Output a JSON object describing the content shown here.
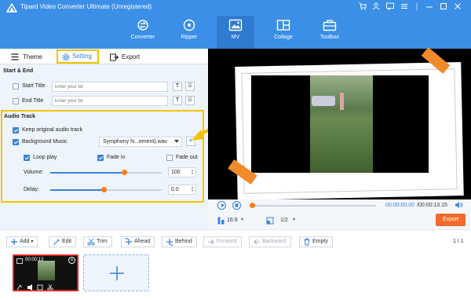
{
  "window": {
    "title": "Tipard Video Converter Ultimate (Unregistered)"
  },
  "nav": {
    "tabs": [
      {
        "label": "Converter",
        "icon": "converter-icon"
      },
      {
        "label": "Ripper",
        "icon": "ripper-icon"
      },
      {
        "label": "MV",
        "icon": "mv-icon",
        "active": true
      },
      {
        "label": "Collage",
        "icon": "collage-icon"
      },
      {
        "label": "Toolbox",
        "icon": "toolbox-icon"
      }
    ]
  },
  "subtabs": {
    "theme": "Theme",
    "setting": "Setting",
    "export": "Export"
  },
  "start_end": {
    "title": "Start & End",
    "start_title": {
      "label": "Start Title",
      "placeholder": "Enter your txt",
      "checked": false
    },
    "end_title": {
      "label": "End Title",
      "placeholder": "Enter your txt",
      "checked": false
    }
  },
  "audio": {
    "title": "Audio Track",
    "keep_original": {
      "label": "Keep original audio track",
      "checked": true
    },
    "background_music": {
      "label": "Background Music",
      "checked": true,
      "selected": "Symphony N...ement).wav"
    },
    "loop_play": {
      "label": "Loop play",
      "checked": true
    },
    "fade_in": {
      "label": "Fade in",
      "checked": true
    },
    "fade_out": {
      "label": "Fade out",
      "checked": false
    },
    "volume": {
      "label": "Volume:",
      "value": "100",
      "level": 0.66
    },
    "delay": {
      "label": "Delay:",
      "value": "0.0",
      "level": 0.48
    }
  },
  "player": {
    "time_current": "00:00:00.00",
    "time_total": "/00:00:13.15",
    "aspect": "16:9",
    "scale": "1/2",
    "export_label": "Export",
    "progress": 0.0
  },
  "toolbar": {
    "add": "Add",
    "edit": "Edit",
    "trim": "Trim",
    "ahead": "Ahead",
    "behind": "Behind",
    "forward": "Forward",
    "backward": "Backward",
    "empty": "Empty",
    "page": "1 / 1"
  },
  "timeline": {
    "clip_duration": "00:00:13"
  },
  "colors": {
    "accent": "#3b8fe6",
    "highlight": "#f2c300",
    "export": "#f26b2a"
  }
}
